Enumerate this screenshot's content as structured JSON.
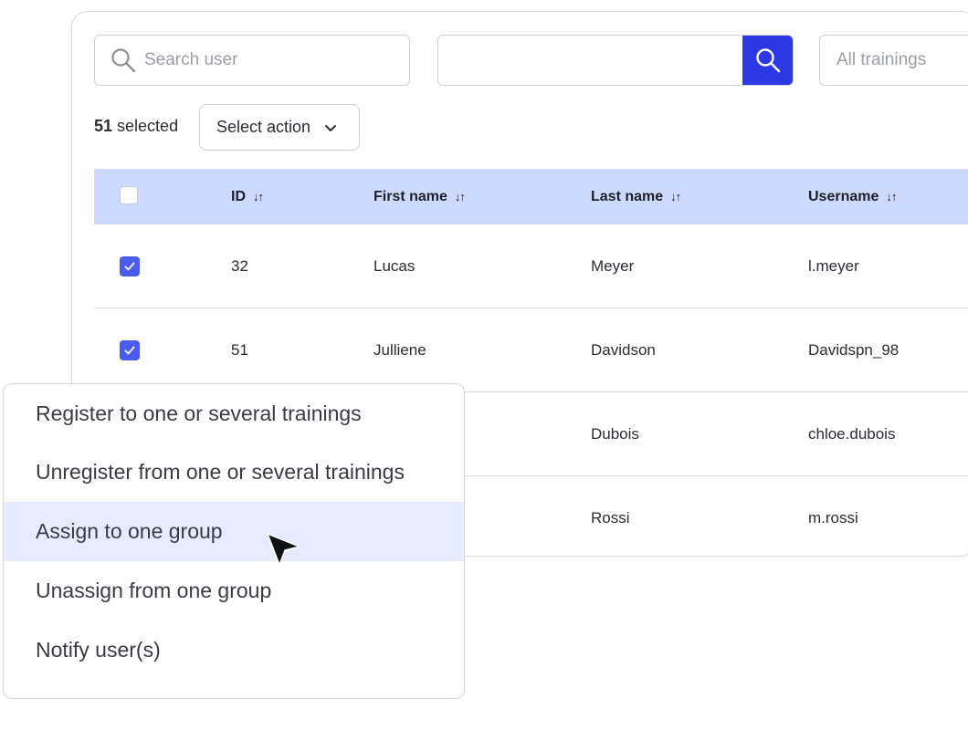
{
  "toolbar": {
    "search_user_placeholder": "Search user",
    "search_value": "",
    "trainings_filter": "All trainings",
    "selected_count": "51",
    "selected_label": " selected",
    "select_action_label": "Select action"
  },
  "table": {
    "columns": [
      "ID",
      "First name",
      "Last name",
      "Username"
    ],
    "rows": [
      {
        "id": "32",
        "first_name": "Lucas",
        "last_name": "Meyer",
        "username": "l.meyer"
      },
      {
        "id": "51",
        "first_name": "Julliene",
        "last_name": "Davidson",
        "username": "Davidspn_98"
      },
      {
        "id": "",
        "first_name": "",
        "last_name": "Dubois",
        "username": "chloe.dubois"
      },
      {
        "id": "",
        "first_name": "",
        "last_name": "Rossi",
        "username": "m.rossi"
      }
    ]
  },
  "action_menu": {
    "items": [
      "Register to one or several trainings",
      "Unregister from one or several trainings",
      "Assign to one group",
      "Unassign from one group",
      "Notify user(s)"
    ],
    "hovered_index": 2
  },
  "colors": {
    "accent": "#2b38e3",
    "checkbox": "#4a5bf0",
    "table_header": "#cdd9ff",
    "menu_hover": "#e6ebff"
  }
}
